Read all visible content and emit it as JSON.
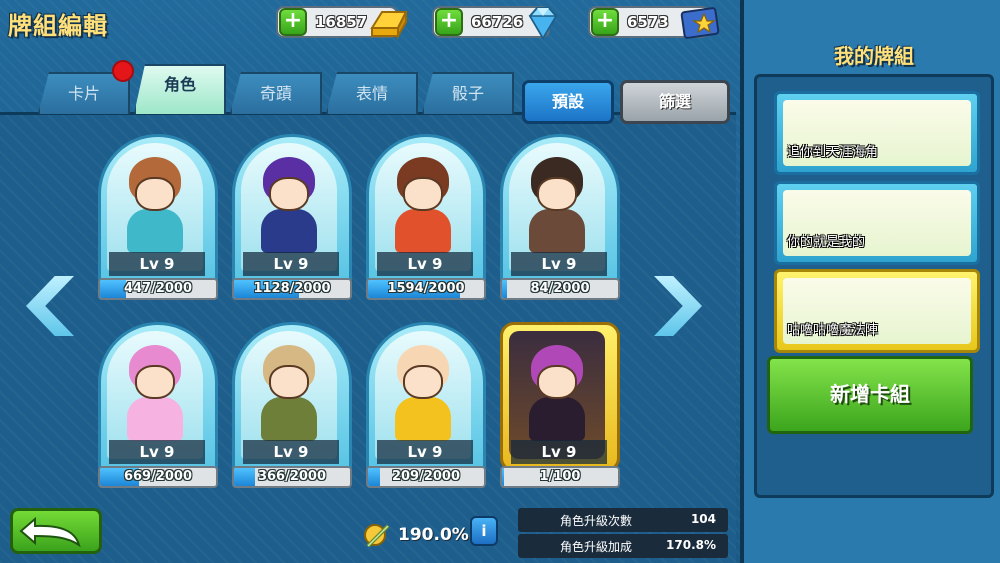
{
  "header": {
    "title": "牌組編輯"
  },
  "currencies": [
    {
      "amount": "16857",
      "icon": "gold-bar-icon"
    },
    {
      "amount": "66726",
      "icon": "diamond-icon"
    },
    {
      "amount": "6573",
      "icon": "star-ticket-icon"
    }
  ],
  "tabs": [
    {
      "label": "卡片",
      "active": false
    },
    {
      "label": "角色",
      "active": true
    },
    {
      "label": "奇蹟",
      "active": false
    },
    {
      "label": "表情",
      "active": false
    },
    {
      "label": "骰子",
      "active": false
    }
  ],
  "buttons": {
    "preset": "預設",
    "filter": "篩選",
    "new_deck": "新增卡組"
  },
  "characters": [
    {
      "level": "Lv 9",
      "progress": "447/2000",
      "fraction": 0.2235,
      "colors": [
        "#b4693a",
        "#3fb8c9"
      ]
    },
    {
      "level": "Lv 9",
      "progress": "1128/2000",
      "fraction": 0.564,
      "colors": [
        "#5a2fa3",
        "#2a3b8c"
      ]
    },
    {
      "level": "Lv 9",
      "progress": "1594/2000",
      "fraction": 0.797,
      "colors": [
        "#7a3b22",
        "#e1512b"
      ]
    },
    {
      "level": "Lv 9",
      "progress": "84/2000",
      "fraction": 0.042,
      "colors": [
        "#3b2a22",
        "#6b4a3a"
      ]
    },
    {
      "level": "Lv 9",
      "progress": "669/2000",
      "fraction": 0.3345,
      "colors": [
        "#e78ad0",
        "#f6b2e0"
      ]
    },
    {
      "level": "Lv 9",
      "progress": "366/2000",
      "fraction": 0.183,
      "colors": [
        "#d5b884",
        "#6e7f3a"
      ]
    },
    {
      "level": "Lv 9",
      "progress": "209/2000",
      "fraction": 0.1045,
      "colors": [
        "#f7d6b4",
        "#f4c21e"
      ]
    },
    {
      "level": "Lv 9",
      "progress": "1/100",
      "fraction": 0.01,
      "colors": [
        "#b048b7",
        "#2a1d30"
      ]
    }
  ],
  "bottom": {
    "bonus_value": "190.0%",
    "info_label": "i",
    "stats": [
      {
        "label": "角色升級次數",
        "value": "104"
      },
      {
        "label": "角色升級加成",
        "value": "170.8%"
      }
    ]
  },
  "right_panel": {
    "title": "我的牌組",
    "decks": [
      {
        "name": "追你到天涯海角",
        "selected": false
      },
      {
        "name": "你的就是我的",
        "selected": false
      },
      {
        "name": "咕嚕咕嚕魔法陣",
        "selected": true
      }
    ]
  },
  "colors": {
    "accent_green": "#3ca51d",
    "accent_blue": "#1d74c7",
    "title_yellow": "#ffe07a"
  }
}
